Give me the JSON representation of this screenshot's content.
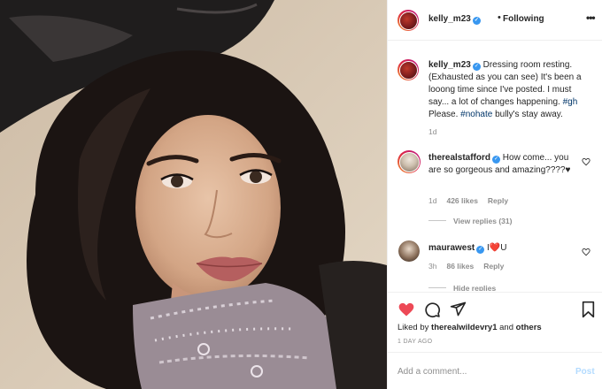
{
  "post": {
    "author": "kelly_m23",
    "follow_status": "Following",
    "separator": "•",
    "more": "•••",
    "colors": {
      "accent": "#3897f0",
      "like": "#ed4956",
      "hashtag": "#003569"
    }
  },
  "caption": {
    "username": "kelly_m23",
    "text_before": " Dressing room resting. (Exhausted as you can see) It's been a looong time since I've posted. I must say... a lot of changes happening. ",
    "hashtag1": "#gh",
    "text_mid": " Please. ",
    "hashtag2": "#nohate",
    "text_after": " bully's stay away.",
    "time": "1d"
  },
  "comments": [
    {
      "username": "therealstafford",
      "text": " How come... you are so gorgeous and amazing????♥",
      "time": "1d",
      "likes": "426 likes",
      "reply": "Reply",
      "view_replies": "View replies (31)"
    },
    {
      "username": "maurawest",
      "text": " I",
      "emoji": "❤️",
      "text_end": "U",
      "time": "3h",
      "likes": "86 likes",
      "reply": "Reply",
      "view_replies": "Hide replies"
    }
  ],
  "actions": {
    "liked_by_prefix": "Liked by ",
    "liked_by_user": "therealwildevry1",
    "liked_by_mid": " and ",
    "liked_by_others": "others",
    "timestamp": "1 DAY AGO"
  },
  "add_comment": {
    "placeholder": "Add a comment...",
    "post_label": "Post"
  },
  "icons": [
    "heart-icon",
    "comment-icon",
    "share-icon",
    "bookmark-icon",
    "more-icon",
    "verified-icon"
  ]
}
